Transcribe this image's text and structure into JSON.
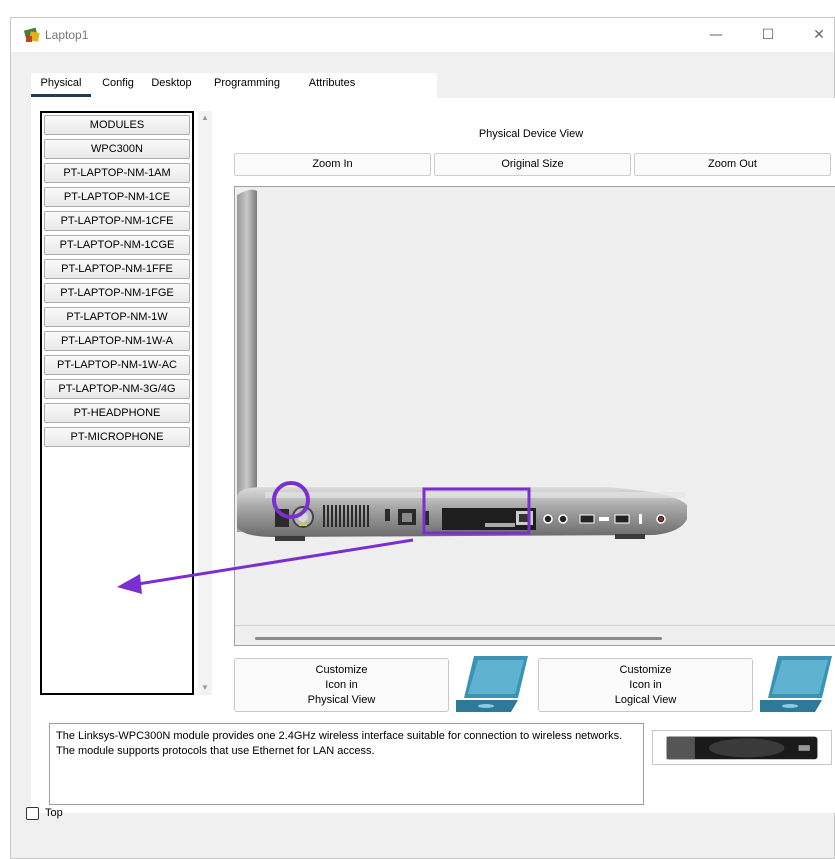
{
  "window": {
    "title": "Laptop1",
    "controls": [
      "—",
      "☐",
      "✕"
    ]
  },
  "tabs": [
    "Physical",
    "Config",
    "Desktop",
    "Programming",
    "Attributes"
  ],
  "active_tab": "Physical",
  "modules": {
    "header": "MODULES",
    "items": [
      "WPC300N",
      "PT-LAPTOP-NM-1AM",
      "PT-LAPTOP-NM-1CE",
      "PT-LAPTOP-NM-1CFE",
      "PT-LAPTOP-NM-1CGE",
      "PT-LAPTOP-NM-1FFE",
      "PT-LAPTOP-NM-1FGE",
      "PT-LAPTOP-NM-1W",
      "PT-LAPTOP-NM-1W-A",
      "PT-LAPTOP-NM-1W-AC",
      "PT-LAPTOP-NM-3G/4G",
      "PT-HEADPHONE",
      "PT-MICROPHONE"
    ]
  },
  "physical_view": {
    "label": "Physical Device View",
    "zoom_in": "Zoom In",
    "original_size": "Original Size",
    "zoom_out": "Zoom Out"
  },
  "customize": {
    "physical": [
      "Customize",
      "Icon in",
      "Physical View"
    ],
    "logical": [
      "Customize",
      "Icon in",
      "Logical View"
    ]
  },
  "description": "The Linksys-WPC300N module provides one 2.4GHz wireless interface suitable for connection to wireless networks. The module supports protocols that use Ethernet for LAN access.",
  "top_checkbox": {
    "label": "Top",
    "checked": false
  },
  "colors": {
    "annotation": "#7b2fd0",
    "tab_underline": "#1f3b5a",
    "laptop_screen": "#3d93b3"
  }
}
